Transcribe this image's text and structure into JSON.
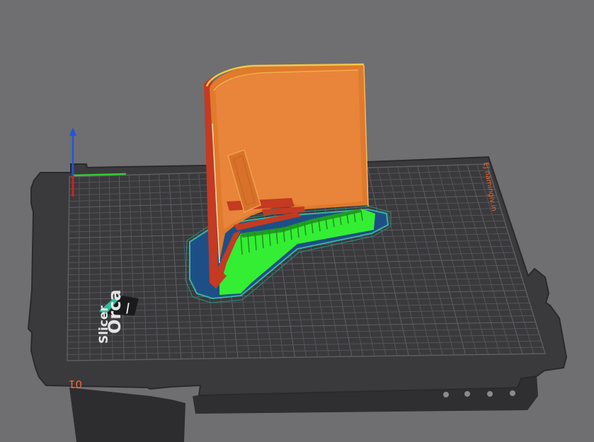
{
  "app": {
    "name": "OrcaSlicer"
  },
  "bed": {
    "logo_line1": "Orca",
    "logo_line2": "Slicer",
    "plate_number": "01",
    "corner_label": "Ej namingiv.in"
  },
  "colors": {
    "background": "#6f6f71",
    "plate": "#3a3a3d",
    "grid": "#54545a",
    "wall_orange": "#e07a2c",
    "wall_red": "#c43a22",
    "support_green": "#33ee33",
    "brim_blue": "#1d4f86",
    "outline_teal": "#37b3a0",
    "axis_x": "#33cc33",
    "axis_y": "#cc2222",
    "axis_z": "#2255dd",
    "plate_number": "#f06a30"
  },
  "icons": [
    "axis-gizmo-icon",
    "orca-logo-icon"
  ]
}
